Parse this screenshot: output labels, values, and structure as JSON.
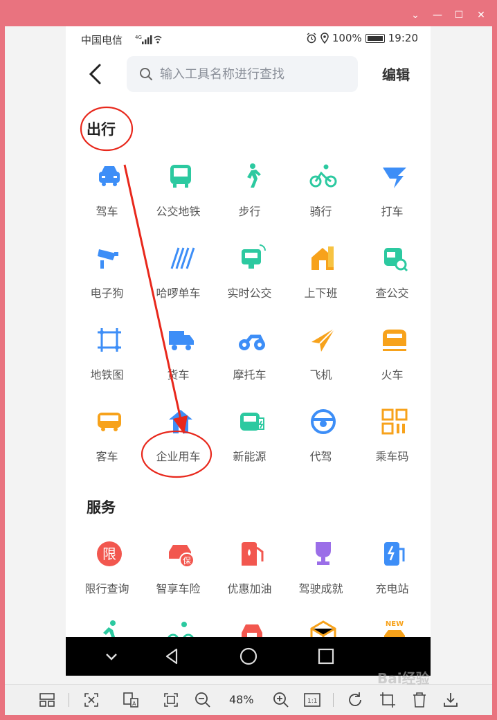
{
  "status": {
    "carrier": "中国电信",
    "net": "4G",
    "battery": "100%",
    "time": "19:20"
  },
  "search": {
    "placeholder": "输入工具名称进行查找"
  },
  "header": {
    "edit_label": "编辑"
  },
  "sections": [
    {
      "title": "出行",
      "items": [
        {
          "label": "驾车",
          "icon": "car-icon",
          "color": "#3d8ef7"
        },
        {
          "label": "公交地铁",
          "icon": "bus-icon",
          "color": "#2cc9a0"
        },
        {
          "label": "步行",
          "icon": "walk-icon",
          "color": "#2cc9a0"
        },
        {
          "label": "骑行",
          "icon": "bike-icon",
          "color": "#2cc9a0"
        },
        {
          "label": "打车",
          "icon": "taxi-icon",
          "color": "#3d8ef7"
        },
        {
          "label": "电子狗",
          "icon": "camera-icon",
          "color": "#3d8ef7"
        },
        {
          "label": "哈啰单车",
          "icon": "hellobike-icon",
          "color": "#3d8ef7"
        },
        {
          "label": "实时公交",
          "icon": "realtime-bus-icon",
          "color": "#2cc9a0"
        },
        {
          "label": "上下班",
          "icon": "home-icon",
          "color": "#f7a21b"
        },
        {
          "label": "查公交",
          "icon": "bus-search-icon",
          "color": "#2cc9a0"
        },
        {
          "label": "地铁图",
          "icon": "metro-map-icon",
          "color": "#3d8ef7"
        },
        {
          "label": "货车",
          "icon": "truck-icon",
          "color": "#3d8ef7"
        },
        {
          "label": "摩托车",
          "icon": "motorcycle-icon",
          "color": "#3d8ef7"
        },
        {
          "label": "飞机",
          "icon": "plane-icon",
          "color": "#f7a21b"
        },
        {
          "label": "火车",
          "icon": "train-icon",
          "color": "#f7a21b"
        },
        {
          "label": "客车",
          "icon": "coach-icon",
          "color": "#f7a21b"
        },
        {
          "label": "企业用车",
          "icon": "enterprise-car-icon",
          "color": "#3d8ef7"
        },
        {
          "label": "新能源",
          "icon": "ev-icon",
          "color": "#2cc9a0"
        },
        {
          "label": "代驾",
          "icon": "steering-wheel-icon",
          "color": "#3d8ef7"
        },
        {
          "label": "乘车码",
          "icon": "qr-code-icon",
          "color": "#f7a21b"
        }
      ]
    },
    {
      "title": "服务",
      "items": [
        {
          "label": "限行查询",
          "icon": "restriction-icon",
          "color": "#f2574f",
          "glyph": "限"
        },
        {
          "label": "智享车险",
          "icon": "insurance-icon",
          "color": "#f2574f",
          "glyph": "保"
        },
        {
          "label": "优惠加油",
          "icon": "fuel-icon",
          "color": "#f2574f"
        },
        {
          "label": "驾驶成就",
          "icon": "trophy-icon",
          "color": "#9b6ee8"
        },
        {
          "label": "充电站",
          "icon": "charging-icon",
          "color": "#3d8ef7"
        }
      ]
    }
  ],
  "partial_row_icons": [
    "runner-icon",
    "cyclist-icon",
    "car-service-icon",
    "box-icon",
    "new-car-icon"
  ],
  "partial_row_badge": "NEW",
  "toolbar": {
    "zoom": "48%"
  }
}
